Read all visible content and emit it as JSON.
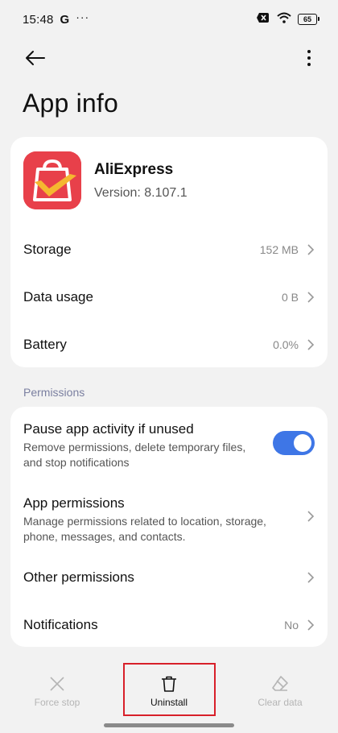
{
  "status_bar": {
    "time": "15:48",
    "g_label": "G",
    "dots": "···",
    "battery": "65"
  },
  "nav": {
    "back_icon": "back-arrow-icon",
    "more_icon": "more-vertical-icon"
  },
  "page": {
    "title": "App info"
  },
  "app": {
    "name": "AliExpress",
    "version": "Version: 8.107.1",
    "icon_colors": {
      "background": "#e8404a",
      "bag": "#ffffff",
      "check": "#f5b730"
    }
  },
  "info_rows": [
    {
      "label": "Storage",
      "value": "152 MB"
    },
    {
      "label": "Data usage",
      "value": "0 B"
    },
    {
      "label": "Battery",
      "value": "0.0%"
    }
  ],
  "permissions_section": {
    "label": "Permissions",
    "pause_activity": {
      "title": "Pause app activity if unused",
      "description": "Remove permissions, delete temporary files, and stop notifications",
      "toggle_on": true
    },
    "app_permissions": {
      "title": "App permissions",
      "description": "Manage permissions related to location, storage, phone, messages, and contacts."
    },
    "other_permissions": {
      "title": "Other permissions"
    },
    "notifications": {
      "title": "Notifications",
      "value": "No"
    }
  },
  "bottom_actions": [
    {
      "label": "Force stop",
      "icon": "close-icon",
      "enabled": false
    },
    {
      "label": "Uninstall",
      "icon": "trash-icon",
      "enabled": true
    },
    {
      "label": "Clear data",
      "icon": "eraser-icon",
      "enabled": false
    }
  ],
  "colors": {
    "accent": "#3e76e6",
    "highlight": "#d8202a",
    "background": "#f2f2f2"
  }
}
